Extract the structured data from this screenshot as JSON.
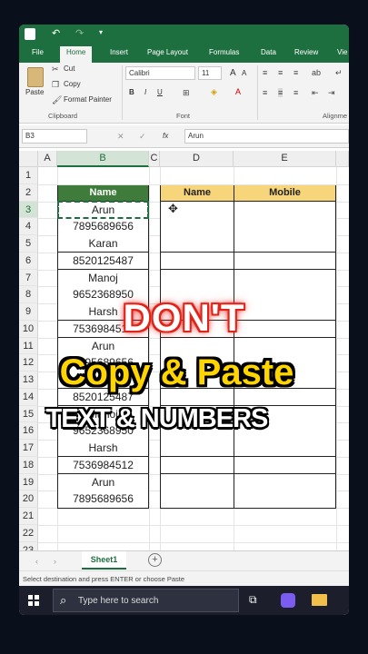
{
  "toolbar": {
    "tabs": [
      "File",
      "Home",
      "Insert",
      "Page Layout",
      "Formulas",
      "Data",
      "Review",
      "Vie"
    ]
  },
  "clipboard": {
    "paste": "Paste",
    "cut": "Cut",
    "copy": "Copy",
    "format_painter": "Format Painter",
    "group": "Clipboard"
  },
  "font": {
    "name": "Calibri",
    "size": "11",
    "grow": "A",
    "shrink": "A",
    "bold": "B",
    "italic": "I",
    "underline": "U",
    "group": "Font"
  },
  "alignment": {
    "group": "Alignme"
  },
  "formula_bar": {
    "cell_ref": "B3",
    "fx": "fx",
    "value": "Arun"
  },
  "columns": [
    "A",
    "B",
    "C",
    "D",
    "E"
  ],
  "rows": [
    "1",
    "2",
    "3",
    "4",
    "5",
    "6",
    "7",
    "8",
    "9",
    "10",
    "11",
    "12",
    "13",
    "14",
    "15",
    "16",
    "17",
    "18",
    "19",
    "20",
    "21",
    "22",
    "23"
  ],
  "table1": {
    "header": "Name",
    "values": [
      "Arun",
      "7895689656",
      "Karan",
      "8520125487",
      "Manoj",
      "9652368950",
      "Harsh",
      "7536984512",
      "Arun",
      "7895689656",
      "Karan",
      "8520125487",
      "Manoj",
      "9652368950",
      "Harsh",
      "7536984512",
      "Arun",
      "7895689656"
    ]
  },
  "table2": {
    "header_name": "Name",
    "header_mobile": "Mobile"
  },
  "sheets": {
    "sheet1": "Sheet1",
    "add": "+"
  },
  "status": {
    "text": "Select destination and press ENTER or choose Paste"
  },
  "taskbar": {
    "search_placeholder": "Type here to search"
  },
  "overlay": {
    "line1": "DON'T",
    "line2": "Copy & Paste",
    "line3": "TEXT & NUMBERS"
  },
  "colors": {
    "excel_green": "#1e6f3f",
    "header_green": "#3f7b3a",
    "header_yellow": "#f7d57a",
    "overlay_red": "#e1251b",
    "overlay_yellow": "#ffd500"
  }
}
